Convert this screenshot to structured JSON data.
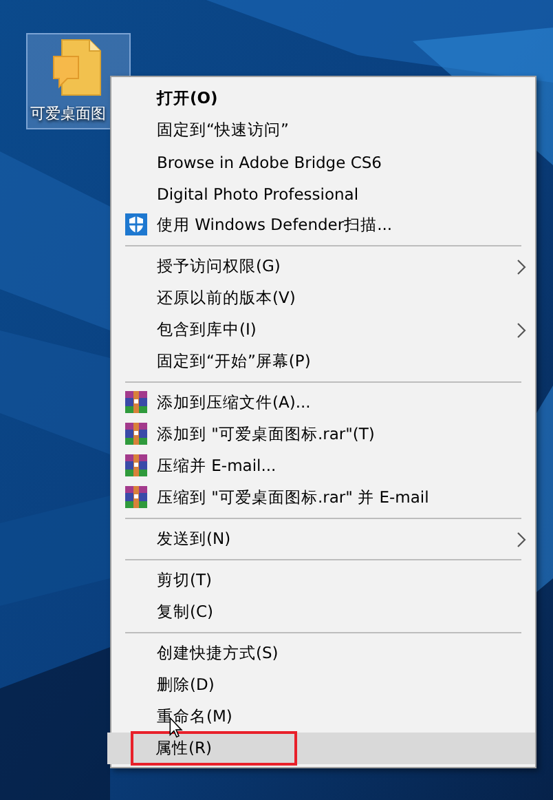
{
  "desktop_icon": {
    "label": "可爱桌面图",
    "selected": true
  },
  "context_menu": {
    "items": [
      {
        "kind": "item",
        "label": "打开(O)",
        "bold": true,
        "submenu": false,
        "selected": false,
        "outlined": false
      },
      {
        "kind": "item",
        "label": "固定到“快速访问”",
        "bold": false,
        "submenu": false,
        "selected": false,
        "outlined": false
      },
      {
        "kind": "item",
        "label": "Browse in Adobe Bridge CS6",
        "bold": false,
        "submenu": false,
        "selected": false,
        "outlined": false
      },
      {
        "kind": "item",
        "label": "Digital Photo Professional",
        "bold": false,
        "submenu": false,
        "selected": false,
        "outlined": false
      },
      {
        "kind": "shield",
        "label": "使用 Windows Defender扫描...",
        "bold": false,
        "submenu": false,
        "selected": false,
        "outlined": false
      },
      {
        "kind": "separator"
      },
      {
        "kind": "item",
        "label": "授予访问权限(G)",
        "bold": false,
        "submenu": true,
        "selected": false,
        "outlined": false
      },
      {
        "kind": "item",
        "label": "还原以前的版本(V)",
        "bold": false,
        "submenu": false,
        "selected": false,
        "outlined": false
      },
      {
        "kind": "item",
        "label": "包含到库中(I)",
        "bold": false,
        "submenu": true,
        "selected": false,
        "outlined": false
      },
      {
        "kind": "item",
        "label": "固定到“开始”屏幕(P)",
        "bold": false,
        "submenu": false,
        "selected": false,
        "outlined": false
      },
      {
        "kind": "separator"
      },
      {
        "kind": "archive",
        "label": "添加到压缩文件(A)...",
        "bold": false,
        "submenu": false,
        "selected": false,
        "outlined": false
      },
      {
        "kind": "archive",
        "label": "添加到 \"可爱桌面图标.rar\"(T)",
        "bold": false,
        "submenu": false,
        "selected": false,
        "outlined": false
      },
      {
        "kind": "archive",
        "label": "压缩并 E-mail...",
        "bold": false,
        "submenu": false,
        "selected": false,
        "outlined": false
      },
      {
        "kind": "archive",
        "label": "压缩到 \"可爱桌面图标.rar\" 并 E-mail",
        "bold": false,
        "submenu": false,
        "selected": false,
        "outlined": false
      },
      {
        "kind": "separator"
      },
      {
        "kind": "item",
        "label": "发送到(N)",
        "bold": false,
        "submenu": true,
        "selected": false,
        "outlined": false
      },
      {
        "kind": "separator"
      },
      {
        "kind": "item",
        "label": "剪切(T)",
        "bold": false,
        "submenu": false,
        "selected": false,
        "outlined": false
      },
      {
        "kind": "item",
        "label": "复制(C)",
        "bold": false,
        "submenu": false,
        "selected": false,
        "outlined": false
      },
      {
        "kind": "separator"
      },
      {
        "kind": "item",
        "label": "创建快捷方式(S)",
        "bold": false,
        "submenu": false,
        "selected": false,
        "outlined": false
      },
      {
        "kind": "item",
        "label": "删除(D)",
        "bold": false,
        "submenu": false,
        "selected": false,
        "outlined": false
      },
      {
        "kind": "item",
        "label": "重命名(M)",
        "bold": false,
        "submenu": false,
        "selected": false,
        "outlined": false
      },
      {
        "kind": "item",
        "label": "属性(R)",
        "bold": false,
        "submenu": false,
        "selected": true,
        "outlined": true
      }
    ]
  }
}
